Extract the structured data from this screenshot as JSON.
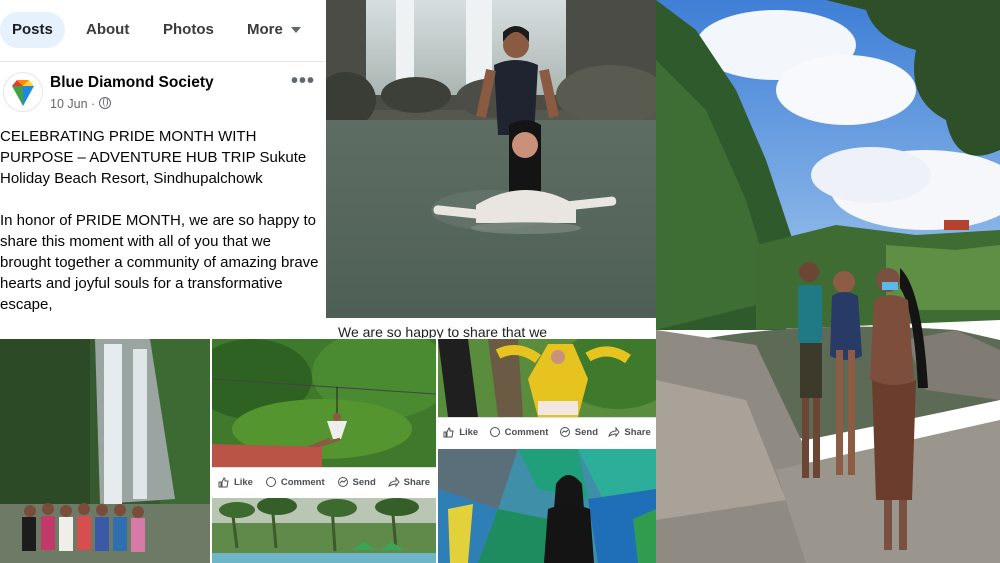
{
  "tabs": [
    {
      "label": "Posts",
      "active": true
    },
    {
      "label": "About",
      "active": false
    },
    {
      "label": "Photos",
      "active": false
    },
    {
      "label": "More",
      "active": false
    }
  ],
  "post": {
    "page_name": "Blue Diamond Society",
    "date": "10 Jun ·",
    "more_icon": "•••",
    "paragraphs": [
      "CELEBRATING PRIDE MONTH WITH PURPOSE – ADVENTURE HUB TRIP Sukute Holiday Beach Resort, Sindhupalchowk",
      "In honor of PRIDE MONTH, we are so happy to share this moment with all of you that we brought together a community of amazing brave hearts and joyful souls for a transformative escape,"
    ]
  },
  "snippet_text": "We are so happy to share that we",
  "actions": {
    "like": "Like",
    "comment": "Comment",
    "send": "Send",
    "share": "Share",
    "share_truncated": "Share"
  },
  "icons": {
    "avatar": "blue-diamond-logo",
    "privacy": "globe-icon",
    "caret": "caret-down-icon",
    "like": "thumbs-up-icon",
    "comment": "comment-bubble-icon",
    "send": "messenger-icon",
    "share": "share-arrow-icon"
  },
  "colors": {
    "active_tab_bg": "#e7f0fd",
    "diamond_blue": "#1e88e5",
    "diamond_red": "#e53935",
    "diamond_yellow": "#fdd835",
    "diamond_green": "#43a047"
  }
}
